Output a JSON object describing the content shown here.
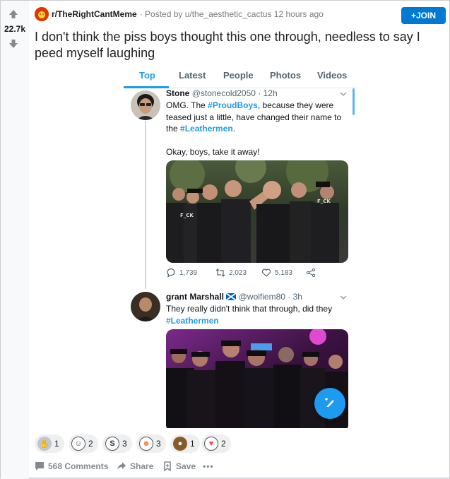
{
  "post": {
    "score": "22.7k",
    "subreddit": "r/TheRightCantMeme",
    "posted_by": "· Posted by u/the_aesthetic_cactus 12 hours ago",
    "join_label": "+JOIN",
    "title": "I don't think the piss boys thought this one through, needless to say I peed myself laughing"
  },
  "screenshot": {
    "tabs": [
      "Top",
      "Latest",
      "People",
      "Photos",
      "Videos"
    ],
    "tweet1": {
      "name": "Stone",
      "handle": "@stonecold2050",
      "time": "· 12h",
      "text_a": "OMG. The ",
      "hashtag1": "#ProudBoys",
      "text_b": ", because they were teased just a little, have changed their name to the ",
      "hashtag2": "#Leathermen",
      "text_c": ".",
      "text_d": "Okay, boys, take it away!",
      "replies": "1,739",
      "retweets": "2,023",
      "likes": "5,183"
    },
    "tweet2": {
      "name": "grant Marshall",
      "handle": "@wolfiem80",
      "time": "· 3h",
      "text": "They really didn't think that through, did they",
      "hashtag": "#Leathermen"
    }
  },
  "awards": [
    {
      "icon": "silver-award-icon",
      "count": "1"
    },
    {
      "icon": "wholesome-award-icon",
      "count": "2"
    },
    {
      "icon": "s-award-icon",
      "count": "3"
    },
    {
      "icon": "laughing-award-icon",
      "count": "3"
    },
    {
      "icon": "bear-award-icon",
      "count": "1"
    },
    {
      "icon": "cheer-award-icon",
      "count": "2"
    }
  ],
  "footer": {
    "comments": "568 Comments",
    "share": "Share",
    "save": "Save",
    "more": "•••"
  },
  "colors": {
    "accent": "#0079d3",
    "twitter_blue": "#1d9bf0",
    "subreddit_icon": "#d93a00"
  }
}
